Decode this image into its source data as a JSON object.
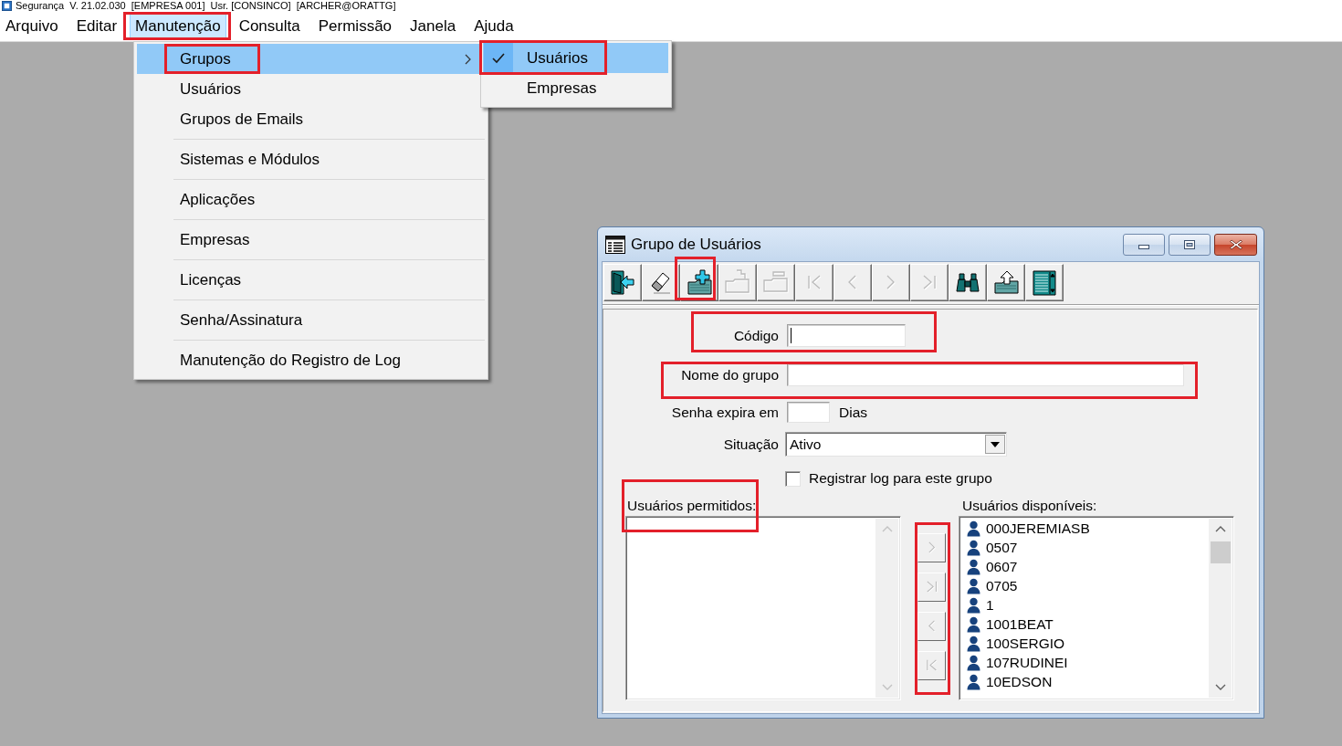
{
  "app_title": {
    "text": "Segurança  V. 21.02.030  [EMPRESA 001]  Usr. [CONSINCO]  [ARCHER@ORATTG]"
  },
  "menubar": {
    "items": [
      {
        "label": "Arquivo",
        "selected": false,
        "highlighted": false
      },
      {
        "label": "Editar",
        "selected": false,
        "highlighted": false
      },
      {
        "label": "Manutenção",
        "selected": true,
        "highlighted": true
      },
      {
        "label": "Consulta",
        "selected": false,
        "highlighted": false
      },
      {
        "label": "Permissão",
        "selected": false,
        "highlighted": false
      },
      {
        "label": "Janela",
        "selected": false,
        "highlighted": false
      },
      {
        "label": "Ajuda",
        "selected": false,
        "highlighted": false
      }
    ]
  },
  "menu": {
    "groups": [
      {
        "items": [
          {
            "label": "Grupos",
            "selected": true,
            "highlighted": true,
            "submenu": true
          },
          {
            "label": "Usuários",
            "selected": false,
            "highlighted": false,
            "submenu": false
          },
          {
            "label": "Grupos de Emails",
            "selected": false,
            "highlighted": false,
            "submenu": false
          }
        ]
      },
      {
        "items": [
          {
            "label": "Sistemas e Módulos",
            "selected": false,
            "highlighted": false,
            "submenu": false
          }
        ]
      },
      {
        "items": [
          {
            "label": "Aplicações",
            "selected": false,
            "highlighted": false,
            "submenu": false
          }
        ]
      },
      {
        "items": [
          {
            "label": "Empresas",
            "selected": false,
            "highlighted": false,
            "submenu": false
          }
        ]
      },
      {
        "items": [
          {
            "label": "Licenças",
            "selected": false,
            "highlighted": false,
            "submenu": false
          }
        ]
      },
      {
        "items": [
          {
            "label": "Senha/Assinatura",
            "selected": false,
            "highlighted": false,
            "submenu": false
          }
        ]
      },
      {
        "items": [
          {
            "label": "Manutenção do Registro de Log",
            "selected": false,
            "highlighted": false,
            "submenu": false
          }
        ]
      }
    ]
  },
  "submenu": {
    "items": [
      {
        "label": "Usuários",
        "checked": true,
        "selected": true,
        "highlighted": true
      },
      {
        "label": "Empresas",
        "checked": false,
        "selected": false,
        "highlighted": false
      }
    ]
  },
  "dialog": {
    "title": "Grupo de Usuários",
    "toolbar": [
      {
        "kind": "exit",
        "disabled": false,
        "highlighted": false
      },
      {
        "kind": "eraser",
        "disabled": false,
        "highlighted": false
      },
      {
        "kind": "new",
        "disabled": false,
        "highlighted": true
      },
      {
        "kind": "copy",
        "disabled": true,
        "highlighted": false
      },
      {
        "kind": "remove",
        "disabled": true,
        "highlighted": false
      },
      {
        "kind": "first",
        "disabled": true,
        "highlighted": false
      },
      {
        "kind": "previous",
        "disabled": true,
        "highlighted": false
      },
      {
        "kind": "next",
        "disabled": true,
        "highlighted": false
      },
      {
        "kind": "last",
        "disabled": true,
        "highlighted": false
      },
      {
        "kind": "search",
        "disabled": false,
        "highlighted": false
      },
      {
        "kind": "export",
        "disabled": false,
        "highlighted": false
      },
      {
        "kind": "grid",
        "disabled": false,
        "highlighted": false
      }
    ],
    "code_field": {
      "label": "Código",
      "focused": true,
      "highlighted": true
    },
    "name_field": {
      "label": "Nome do grupo",
      "highlighted": true
    },
    "expiry_field": {
      "label": "Senha expira em",
      "unit": "Dias"
    },
    "status_field": {
      "label": "Situação",
      "value": "Ativo"
    },
    "log_checkbox": {
      "label": "Registrar log para este grupo",
      "checked": false
    },
    "allowed_users": {
      "label": "Usuários permitidos:",
      "highlighted": true
    },
    "transfer": {
      "highlighted": true,
      "buttons": [
        {
          "kind": "next",
          "disabled": true
        },
        {
          "kind": "last",
          "disabled": true
        },
        {
          "kind": "previous",
          "disabled": true
        },
        {
          "kind": "first",
          "disabled": true
        }
      ]
    },
    "available_users": {
      "label": "Usuários disponíveis:",
      "items": [
        {
          "label": "000JEREMIASB",
          "selected": false
        },
        {
          "label": "0507",
          "selected": false
        },
        {
          "label": "0607",
          "selected": false
        },
        {
          "label": "0705",
          "selected": false
        },
        {
          "label": "1",
          "selected": false
        },
        {
          "label": "1001BEAT",
          "selected": false
        },
        {
          "label": "100SERGIO",
          "selected": false
        },
        {
          "label": "107RUDINEI",
          "selected": false
        },
        {
          "label": "10EDSON",
          "selected": false
        }
      ]
    }
  }
}
